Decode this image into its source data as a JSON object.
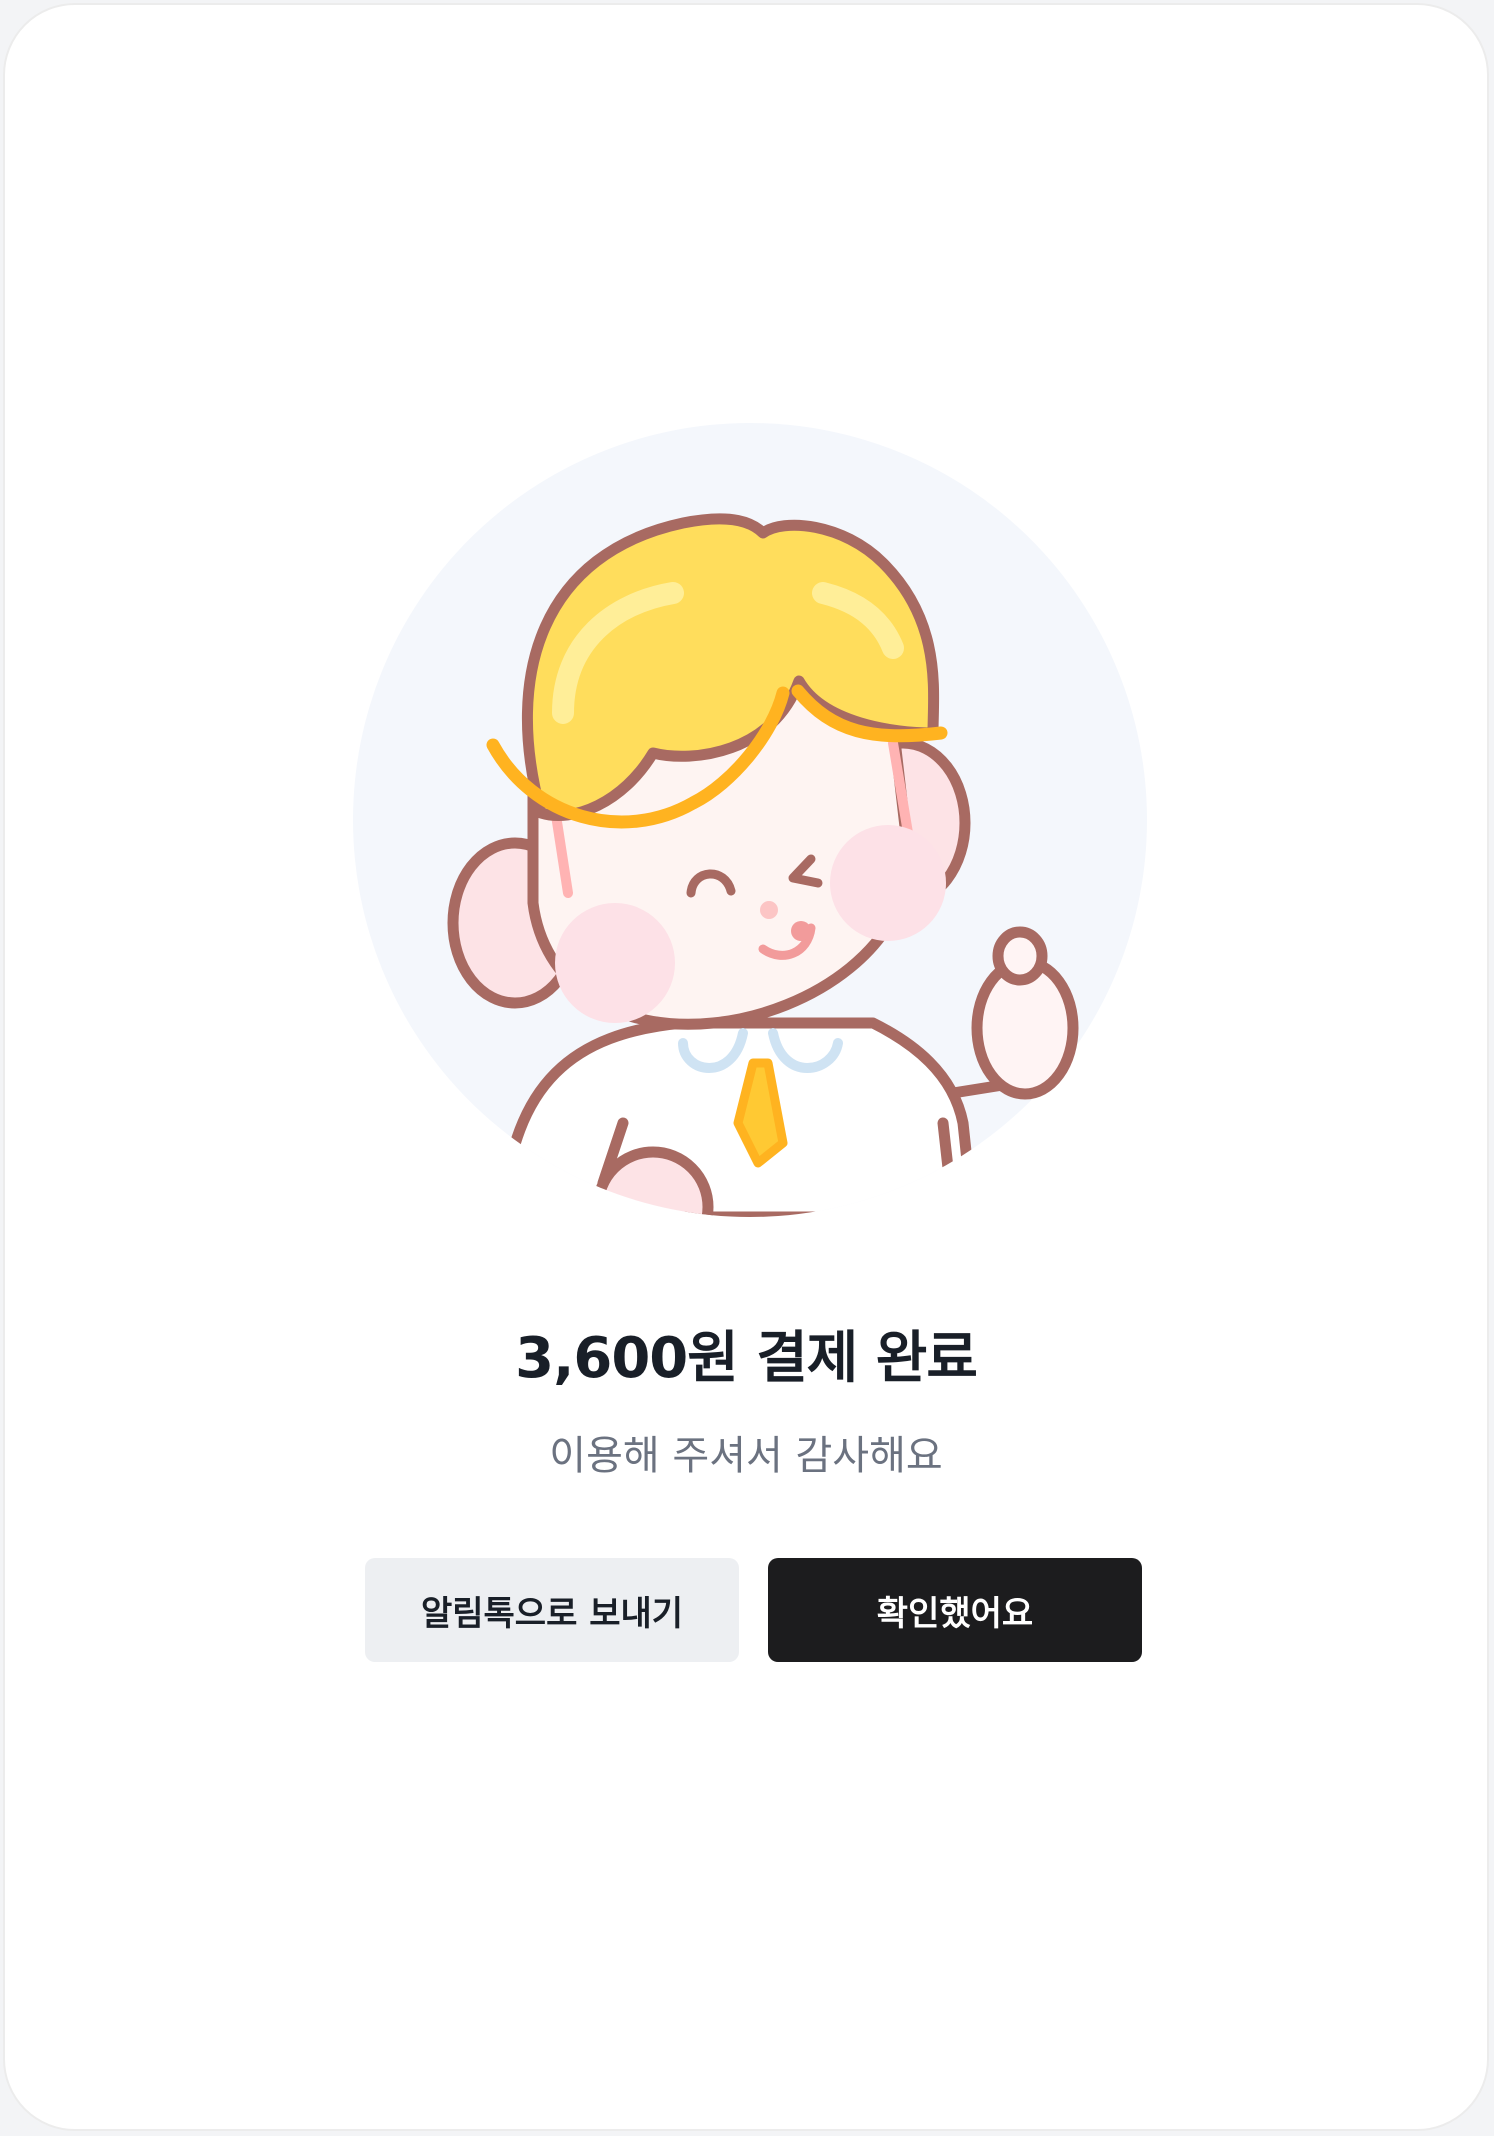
{
  "result": {
    "title": "3,600원 결제 완료",
    "subtitle": "이용해 주셔서 감사해요"
  },
  "actions": {
    "share_label": "알림톡으로 보내기",
    "confirm_label": "확인했어요"
  },
  "colors": {
    "primary_button": "#1c1c1e",
    "secondary_button": "#edeff2",
    "illustration_bg": "#f4f7fc",
    "hair": "#ffdd5c",
    "outline": "#a86a62"
  },
  "illustration": {
    "icon": "thumbs-up-character"
  }
}
